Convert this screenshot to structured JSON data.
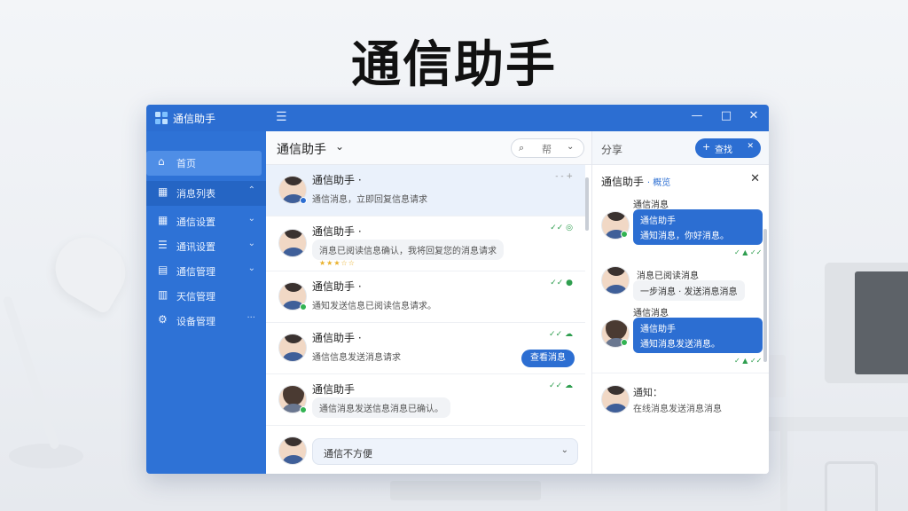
{
  "page_title": "通信助手",
  "window": {
    "app_name": "通信助手",
    "controls": {
      "minimize": "—",
      "maximize": "□",
      "close": "✕"
    }
  },
  "sidebar": {
    "items": [
      {
        "label": "首页",
        "icon": "home-icon",
        "glyph": "⌂"
      },
      {
        "label": "消息列表",
        "icon": "grid-icon",
        "glyph": "▦",
        "chevron": "⌃"
      },
      {
        "label": "通信设置",
        "icon": "grid-icon",
        "glyph": "▦",
        "chevron": "⌄"
      },
      {
        "label": "通讯设置",
        "icon": "list-icon",
        "glyph": "☰",
        "chevron": "⌄"
      },
      {
        "label": "通信管理",
        "icon": "file-icon",
        "glyph": "▤",
        "chevron": "⌄"
      },
      {
        "label": "天信管理",
        "icon": "chart-icon",
        "glyph": "▥"
      },
      {
        "label": "设备管理",
        "icon": "gear-icon",
        "glyph": "⚙",
        "chevron": "···"
      }
    ]
  },
  "main": {
    "title": "通信助手",
    "title_chevron": "⌄",
    "search": {
      "icon": "⌕",
      "text": "帮",
      "chevron": "⌄"
    },
    "conversations": [
      {
        "name": "通信助手 ·",
        "snippet": "通信消息，立即回复信息请求",
        "meta": "- - +",
        "meta_grey": true
      },
      {
        "name": "通信助手 ·",
        "snippet": "消息已阅读信息确认，我将回复您的消息请求",
        "meta": "✓✓ ◎",
        "stars": "★★★☆☆"
      },
      {
        "name": "通信助手 ·",
        "snippet": "通知发送信息已阅读信息请求。",
        "meta": "✓✓ ●"
      },
      {
        "name": "通信助手 ·",
        "snippet": "通信信息发送消息请求",
        "meta": "✓✓ ☁",
        "action": "查看消息"
      },
      {
        "name": "通信助手",
        "snippet": "通信消息发送信息消息已确认。",
        "meta": "✓✓ ☁"
      }
    ],
    "compose": {
      "text": "通信不方便",
      "chevron": "⌄"
    }
  },
  "right": {
    "header_label": "分享",
    "add_button": {
      "plus": "+",
      "label": "查找",
      "x": "✕"
    },
    "title": "通信助手",
    "title_tag": "· 概览",
    "close": "✕",
    "messages": [
      {
        "label": "通信消息",
        "text": "通信助手",
        "text2": "通知消息，你好消息。",
        "meta": "✓ ▲ ✓✓"
      },
      {
        "label": "",
        "grey": "消息已阅读消息",
        "grey2": "一步消息 · 发送消息消息"
      },
      {
        "label": "通信消息",
        "text": "通信助手",
        "text2": "通知消息发送消息。",
        "meta": "✓ ▲ ✓✓"
      },
      {
        "label": "通知：",
        "grey": "在线消息发送消息消息"
      }
    ]
  }
}
